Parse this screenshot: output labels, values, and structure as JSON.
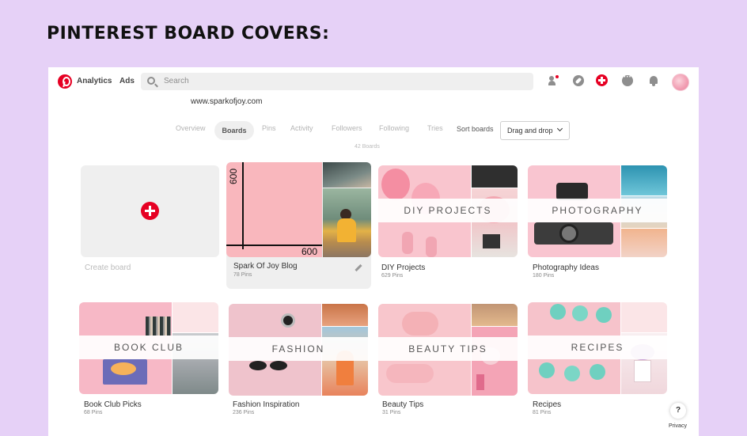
{
  "heading": "PINTEREST BOARD COVERS:",
  "topbar": {
    "analytics": "Analytics",
    "ads": "Ads",
    "search_placeholder": "Search",
    "icons": [
      "pinterest-logo",
      "search-icon",
      "people-icon",
      "compass-icon",
      "add-icon",
      "chat-icon",
      "bell-icon",
      "avatar"
    ]
  },
  "profile": {
    "url": "www.sparkofjoy.com"
  },
  "tabs": {
    "items": [
      "Overview",
      "Boards",
      "Pins",
      "Activity",
      "Followers",
      "Following",
      "Tries"
    ],
    "active": "Boards",
    "sort_label": "Sort boards",
    "sort_value": "Drag and drop",
    "board_count": "42 Boards"
  },
  "create_board": {
    "label": "Create board"
  },
  "boards": [
    {
      "name": "Spark Of Joy Blog",
      "pins": "78 Pins",
      "cover_text": "",
      "guide_labels": [
        "600",
        "600"
      ]
    },
    {
      "name": "DIY Projects",
      "pins": "629 Pins",
      "cover_text": "DIY PROJECTS"
    },
    {
      "name": "Photography Ideas",
      "pins": "180 Pins",
      "cover_text": "PHOTOGRAPHY"
    },
    {
      "name": "Book Club Picks",
      "pins": "68 Pins",
      "cover_text": "BOOK CLUB"
    },
    {
      "name": "Fashion Inspiration",
      "pins": "236 Pins",
      "cover_text": "FASHION"
    },
    {
      "name": "Beauty Tips",
      "pins": "31 Pins",
      "cover_text": "BEAUTY TIPS"
    },
    {
      "name": "Recipes",
      "pins": "81 Pins",
      "cover_text": "RECIPES"
    }
  ],
  "help": {
    "question": "?",
    "privacy": "Privacy"
  },
  "colors": {
    "page_bg": "#e6d1f7",
    "brand_red": "#e60023",
    "cover_pink": "#f9b7bd"
  }
}
